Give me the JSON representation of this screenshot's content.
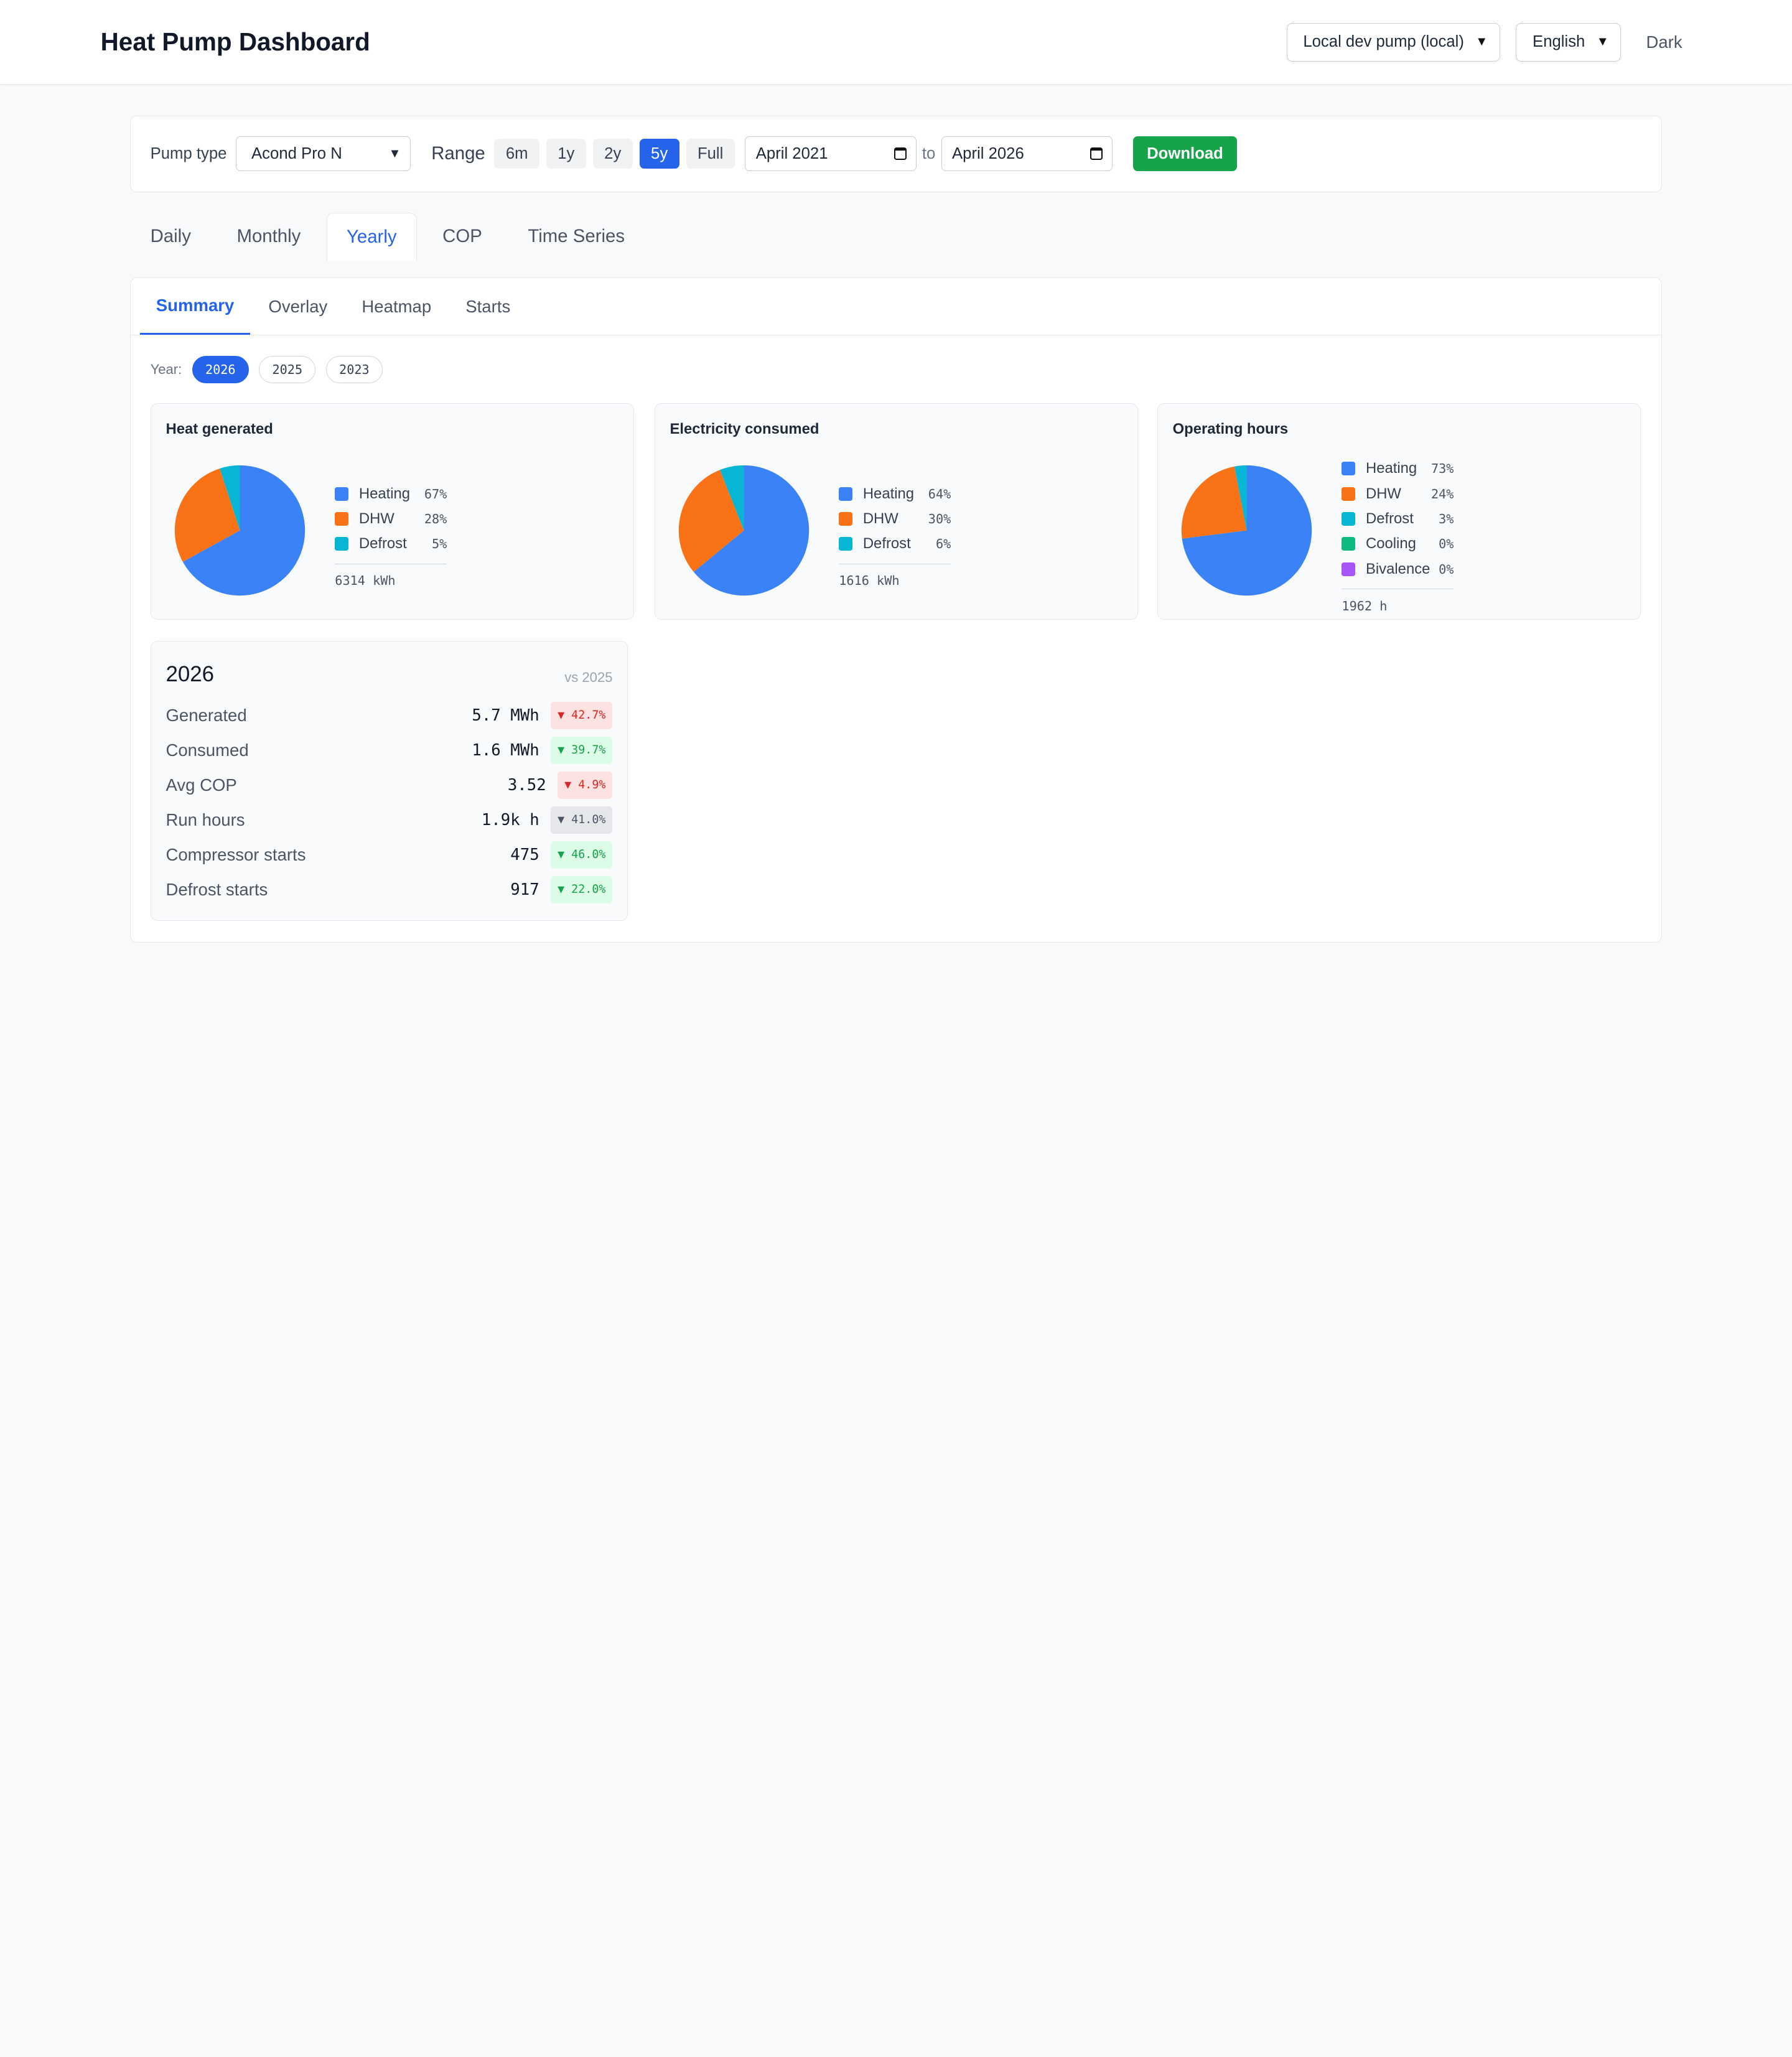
{
  "header": {
    "title": "Heat Pump Dashboard",
    "pump_select": "Local dev pump (local)",
    "language_select": "English",
    "theme_toggle": "Dark"
  },
  "controls": {
    "pump_type_label": "Pump type",
    "pump_type_value": "Acond Pro N",
    "range_label": "Range",
    "range_options": [
      "6m",
      "1y",
      "2y",
      "5y",
      "Full"
    ],
    "range_active": "5y",
    "date_from": "April 2021",
    "to_label": "to",
    "date_to": "April 2026",
    "download_label": "Download"
  },
  "main_tabs": [
    "Daily",
    "Monthly",
    "Yearly",
    "COP",
    "Time Series"
  ],
  "main_tab_active": "Yearly",
  "sub_tabs": [
    "Summary",
    "Overlay",
    "Heatmap",
    "Starts"
  ],
  "sub_tab_active": "Summary",
  "year_selector": {
    "label": "Year:",
    "years": [
      "2026",
      "2025",
      "2023"
    ],
    "active": "2026"
  },
  "colors": {
    "Heating": "#3b82f6",
    "DHW": "#f97316",
    "Defrost": "#06b6d4",
    "Cooling": "#10b981",
    "Bivalence": "#a855f7"
  },
  "chart_data": [
    {
      "type": "pie",
      "title": "Heat generated",
      "slices": [
        {
          "name": "Heating",
          "value": 67,
          "label": "67%"
        },
        {
          "name": "DHW",
          "value": 28,
          "label": "28%"
        },
        {
          "name": "Defrost",
          "value": 5,
          "label": "5%"
        }
      ],
      "total": "6314 kWh"
    },
    {
      "type": "pie",
      "title": "Electricity consumed",
      "slices": [
        {
          "name": "Heating",
          "value": 64,
          "label": "64%"
        },
        {
          "name": "DHW",
          "value": 30,
          "label": "30%"
        },
        {
          "name": "Defrost",
          "value": 6,
          "label": "6%"
        }
      ],
      "total": "1616 kWh"
    },
    {
      "type": "pie",
      "title": "Operating hours",
      "slices": [
        {
          "name": "Heating",
          "value": 73,
          "label": "73%"
        },
        {
          "name": "DHW",
          "value": 24,
          "label": "24%"
        },
        {
          "name": "Defrost",
          "value": 3,
          "label": "3%"
        },
        {
          "name": "Cooling",
          "value": 0,
          "label": "0%"
        },
        {
          "name": "Bivalence",
          "value": 0,
          "label": "0%"
        }
      ],
      "total": "1962 h"
    }
  ],
  "summary": {
    "year": "2026",
    "comparison": "vs 2025",
    "rows": [
      {
        "label": "Generated",
        "value": "5.7 MWh",
        "delta": "▼ 42.7%",
        "tone": "red"
      },
      {
        "label": "Consumed",
        "value": "1.6 MWh",
        "delta": "▼ 39.7%",
        "tone": "green"
      },
      {
        "label": "Avg COP",
        "value": "3.52",
        "delta": "▼ 4.9%",
        "tone": "red"
      },
      {
        "label": "Run hours",
        "value": "1.9k h",
        "delta": "▼ 41.0%",
        "tone": "gray"
      },
      {
        "label": "Compressor starts",
        "value": "475",
        "delta": "▼ 46.0%",
        "tone": "green"
      },
      {
        "label": "Defrost starts",
        "value": "917",
        "delta": "▼ 22.0%",
        "tone": "green"
      }
    ]
  }
}
